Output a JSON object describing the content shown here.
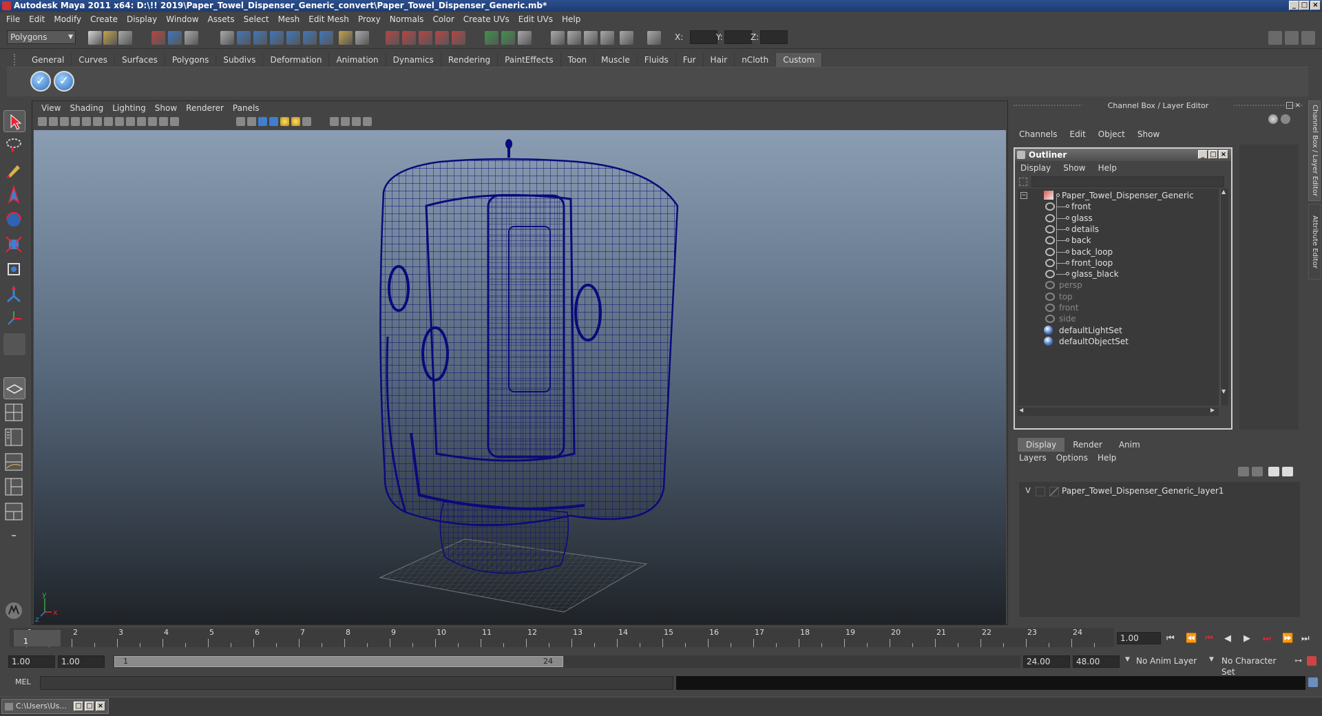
{
  "window": {
    "title": "Autodesk Maya 2011 x64: D:\\!! 2019\\Paper_Towel_Dispenser_Generic_convert\\Paper_Towel_Dispenser_Generic.mb*"
  },
  "menubar": [
    "File",
    "Edit",
    "Modify",
    "Create",
    "Display",
    "Window",
    "Assets",
    "Select",
    "Mesh",
    "Edit Mesh",
    "Proxy",
    "Normals",
    "Color",
    "Create UVs",
    "Edit UVs",
    "Help"
  ],
  "statusline": {
    "mode": "Polygons",
    "x_label": "X:",
    "y_label": "Y:",
    "z_label": "Z:"
  },
  "shelf": {
    "tabs": [
      "General",
      "Curves",
      "Surfaces",
      "Polygons",
      "Subdivs",
      "Deformation",
      "Animation",
      "Dynamics",
      "Rendering",
      "PaintEffects",
      "Toon",
      "Muscle",
      "Fluids",
      "Fur",
      "Hair",
      "nCloth",
      "Custom"
    ],
    "selected": "Custom"
  },
  "viewport": {
    "menu": [
      "View",
      "Shading",
      "Lighting",
      "Show",
      "Renderer",
      "Panels"
    ],
    "axis_y": "y",
    "axis_x": "x",
    "axis_z": "z"
  },
  "channelbox": {
    "title": "Channel Box / Layer Editor",
    "menu": [
      "Channels",
      "Edit",
      "Object",
      "Show"
    ],
    "side_tabs": [
      "Channel Box / Layer Editor",
      "Attribute Editor"
    ]
  },
  "outliner": {
    "title": "Outliner",
    "menu": [
      "Display",
      "Show",
      "Help"
    ],
    "items": [
      {
        "label": "Paper_Towel_Dispenser_Generic",
        "indent": 0,
        "dim": false,
        "icon": "mesh-group-icon"
      },
      {
        "label": "front",
        "indent": 1,
        "dim": false,
        "icon": "eye-icon"
      },
      {
        "label": "glass",
        "indent": 1,
        "dim": false,
        "icon": "eye-icon"
      },
      {
        "label": "details",
        "indent": 1,
        "dim": false,
        "icon": "eye-icon"
      },
      {
        "label": "back",
        "indent": 1,
        "dim": false,
        "icon": "eye-icon"
      },
      {
        "label": "back_loop",
        "indent": 1,
        "dim": false,
        "icon": "eye-icon"
      },
      {
        "label": "front_loop",
        "indent": 1,
        "dim": false,
        "icon": "eye-icon"
      },
      {
        "label": "glass_black",
        "indent": 1,
        "dim": false,
        "icon": "eye-icon"
      },
      {
        "label": "persp",
        "indent": 0,
        "dim": true,
        "icon": "camera-icon"
      },
      {
        "label": "top",
        "indent": 0,
        "dim": true,
        "icon": "camera-icon"
      },
      {
        "label": "front",
        "indent": 0,
        "dim": true,
        "icon": "camera-icon"
      },
      {
        "label": "side",
        "indent": 0,
        "dim": true,
        "icon": "camera-icon"
      },
      {
        "label": "defaultLightSet",
        "indent": 0,
        "dim": false,
        "icon": "set-icon"
      },
      {
        "label": "defaultObjectSet",
        "indent": 0,
        "dim": false,
        "icon": "set-icon"
      }
    ]
  },
  "layers": {
    "tabs": [
      "Display",
      "Render",
      "Anim"
    ],
    "selected": "Display",
    "menu": [
      "Layers",
      "Options",
      "Help"
    ],
    "rows": [
      {
        "visible": "V",
        "name": "Paper_Towel_Dispenser_Generic_layer1"
      }
    ]
  },
  "timeline": {
    "ticks": [
      "1",
      "2",
      "3",
      "4",
      "5",
      "6",
      "7",
      "8",
      "9",
      "10",
      "11",
      "12",
      "13",
      "14",
      "15",
      "16",
      "17",
      "18",
      "19",
      "20",
      "21",
      "22",
      "23",
      "24"
    ],
    "current": "1",
    "current_time": "1.00"
  },
  "range": {
    "start": "1.00",
    "start2": "1.00",
    "slider_start": "1",
    "slider_end": "24",
    "end": "24.00",
    "end2": "48.00",
    "anim_layer": "No Anim Layer",
    "char_set": "No Character Set"
  },
  "cmdline": {
    "label": "MEL"
  },
  "taskbar": {
    "item": "C:\\Users\\Us..."
  },
  "colors": {
    "wire": "#0a0a7a",
    "viewport_top": "#8a9db3",
    "viewport_bottom": "#1f2328"
  }
}
